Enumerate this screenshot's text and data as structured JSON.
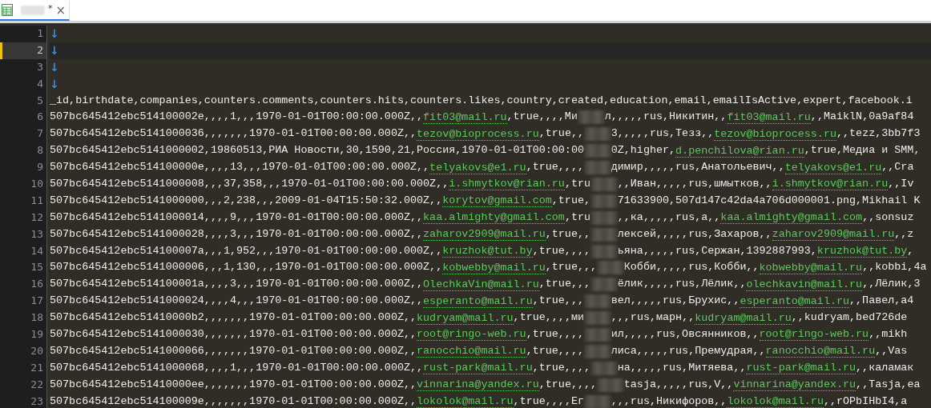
{
  "tab": {
    "modified_mark": "*",
    "close": "×",
    "selected": true
  },
  "editor": {
    "lines": [
      {
        "number": "1",
        "current": false,
        "bookmarked": false,
        "segments": [
          {
            "kind": "eol",
            "text": "↓"
          }
        ]
      },
      {
        "number": "2",
        "current": true,
        "bookmarked": true,
        "segments": [
          {
            "kind": "eol",
            "text": "↓"
          }
        ]
      },
      {
        "number": "3",
        "segments": [
          {
            "kind": "eol",
            "text": "↓"
          }
        ]
      },
      {
        "number": "4",
        "segments": [
          {
            "kind": "eol",
            "text": "↓"
          }
        ]
      },
      {
        "number": "5",
        "segments": [
          {
            "kind": "text",
            "text": "_id,birthdate,companies,counters.comments,counters.hits,counters.likes,country,created,education,email,emailIsActive,expert,facebook.i"
          }
        ]
      },
      {
        "number": "6",
        "segments": [
          {
            "kind": "text",
            "text": "507bc645412ebc514100002e,,,,1,,,1970-01-01T00:00:00.000Z,,"
          },
          {
            "kind": "link",
            "text": "fit03@mail.ru"
          },
          {
            "kind": "text",
            "text": ",true,,,,Ми"
          },
          {
            "kind": "blur"
          },
          {
            "kind": "text",
            "text": "л,,,,,rus,Никитин,,"
          },
          {
            "kind": "link",
            "text": "fit03@mail.ru"
          },
          {
            "kind": "text",
            "text": ",,MaiklN,0a9af84"
          }
        ]
      },
      {
        "number": "7",
        "segments": [
          {
            "kind": "text",
            "text": "507bc645412ebc5141000036,,,,,,,1970-01-01T00:00:00.000Z,,"
          },
          {
            "kind": "link",
            "text": "tezov@bioprocess.ru"
          },
          {
            "kind": "text",
            "text": ",true,,"
          },
          {
            "kind": "blur"
          },
          {
            "kind": "text",
            "text": "3,,,,,rus,Тезз,,"
          },
          {
            "kind": "link",
            "text": "tezov@bioprocess.ru"
          },
          {
            "kind": "text",
            "text": ",,tezz,3bb7f3"
          }
        ]
      },
      {
        "number": "8",
        "segments": [
          {
            "kind": "text",
            "text": "507bc645412ebc5141000002,19860513,РИА Новости,30,1590,21,Россия,1970-01-01T00:00:00"
          },
          {
            "kind": "blur"
          },
          {
            "kind": "text",
            "text": "0Z,higher,"
          },
          {
            "kind": "link",
            "text": "d.penchilova@rian.ru"
          },
          {
            "kind": "text",
            "text": ",true,Медиа и SMM,"
          }
        ]
      },
      {
        "number": "9",
        "segments": [
          {
            "kind": "text",
            "text": "507bc645412ebc514100000e,,,,13,,,1970-01-01T00:00:00.000Z,,"
          },
          {
            "kind": "link",
            "text": "telyakovs@e1.ru"
          },
          {
            "kind": "text",
            "text": ",true,,,,"
          },
          {
            "kind": "blur"
          },
          {
            "kind": "text",
            "text": "димир,,,,,rus,Анатольевич,,"
          },
          {
            "kind": "link",
            "text": "telyakovs@e1.ru"
          },
          {
            "kind": "text",
            "text": ",,Cra"
          }
        ]
      },
      {
        "number": "10",
        "segments": [
          {
            "kind": "text",
            "text": "507bc645412ebc5141000008,,,37,358,,,1970-01-01T00:00:00.000Z,,"
          },
          {
            "kind": "link",
            "text": "i.shmytkov@rian.ru"
          },
          {
            "kind": "text",
            "text": ",tru"
          },
          {
            "kind": "blur"
          },
          {
            "kind": "text",
            "text": ",,Иван,,,,,rus,шмытков,,"
          },
          {
            "kind": "link",
            "text": "i.shmytkov@rian.ru"
          },
          {
            "kind": "text",
            "text": ",,Iv"
          }
        ]
      },
      {
        "number": "11",
        "segments": [
          {
            "kind": "text",
            "text": "507bc645412ebc5141000000,,,2,238,,,2009-01-04T15:50:32.000Z,,"
          },
          {
            "kind": "link",
            "text": "korytov@gmail.com"
          },
          {
            "kind": "text",
            "text": ",true,"
          },
          {
            "kind": "blur"
          },
          {
            "kind": "text",
            "text": "71633900,507d147c42da4a706d000001.png,Mikhail K"
          }
        ]
      },
      {
        "number": "12",
        "segments": [
          {
            "kind": "text",
            "text": "507bc645412ebc5141000014,,,,9,,,1970-01-01T00:00:00.000Z,,"
          },
          {
            "kind": "link",
            "text": "kaa.almighty@gmail.com"
          },
          {
            "kind": "text",
            "text": ",tru"
          },
          {
            "kind": "blur"
          },
          {
            "kind": "text",
            "text": ",,ка,,,,,rus,а,,"
          },
          {
            "kind": "link",
            "text": "kaa.almighty@gmail.com"
          },
          {
            "kind": "text",
            "text": ",,sonsuz"
          }
        ]
      },
      {
        "number": "13",
        "segments": [
          {
            "kind": "text",
            "text": "507bc645412ebc5141000028,,,,3,,,1970-01-01T00:00:00.000Z,,"
          },
          {
            "kind": "link",
            "text": "zaharov2909@mail.ru"
          },
          {
            "kind": "text",
            "text": ",true,,"
          },
          {
            "kind": "blur"
          },
          {
            "kind": "text",
            "text": "лексей,,,,,rus,Захаров,,"
          },
          {
            "kind": "link",
            "text": "zaharov2909@mail.ru"
          },
          {
            "kind": "text",
            "text": ",,z"
          }
        ]
      },
      {
        "number": "14",
        "segments": [
          {
            "kind": "text",
            "text": "507bc645412ebc514100007a,,,1,952,,,1970-01-01T00:00:00.000Z,,"
          },
          {
            "kind": "link",
            "text": "kruzhok@tut.by"
          },
          {
            "kind": "text",
            "text": ",true,,,,"
          },
          {
            "kind": "blur"
          },
          {
            "kind": "text",
            "text": "ьяна,,,,,rus,Сержан,1392887993,"
          },
          {
            "kind": "link",
            "text": "kruzhok@tut.by"
          },
          {
            "kind": "text",
            "text": ","
          }
        ]
      },
      {
        "number": "15",
        "segments": [
          {
            "kind": "text",
            "text": "507bc645412ebc5141000006,,,1,130,,,1970-01-01T00:00:00.000Z,,"
          },
          {
            "kind": "link",
            "text": "kobwebby@mail.ru"
          },
          {
            "kind": "text",
            "text": ",true,,,"
          },
          {
            "kind": "blur"
          },
          {
            "kind": "text",
            "text": "Кобби,,,,,rus,Кобби,,"
          },
          {
            "kind": "link",
            "text": "kobwebby@mail.ru"
          },
          {
            "kind": "text",
            "text": ",,kobbi,4a"
          }
        ]
      },
      {
        "number": "16",
        "segments": [
          {
            "kind": "text",
            "text": "507bc645412ebc514100001a,,,,3,,,1970-01-01T00:00:00.000Z,,"
          },
          {
            "kind": "link",
            "text": "OlechkaVin@mail.ru"
          },
          {
            "kind": "text",
            "text": ",true,,,"
          },
          {
            "kind": "blur"
          },
          {
            "kind": "text",
            "text": "ёлик,,,,,rus,Лёлик,,"
          },
          {
            "kind": "link",
            "text": "olechkavin@mail.ru"
          },
          {
            "kind": "text",
            "text": ",,Лёлик,3"
          }
        ]
      },
      {
        "number": "17",
        "segments": [
          {
            "kind": "text",
            "text": "507bc645412ebc5141000024,,,,4,,,1970-01-01T00:00:00.000Z,,"
          },
          {
            "kind": "link",
            "text": "esperanto@mail.ru"
          },
          {
            "kind": "text",
            "text": ",true,,,"
          },
          {
            "kind": "blur"
          },
          {
            "kind": "text",
            "text": "вел,,,,,rus,Брухис,,"
          },
          {
            "kind": "link",
            "text": "esperanto@mail.ru"
          },
          {
            "kind": "text",
            "text": ",,Павел,а4"
          }
        ]
      },
      {
        "number": "18",
        "segments": [
          {
            "kind": "text",
            "text": "507bc645412ebc51410000b2,,,,,,,1970-01-01T00:00:00.000Z,,"
          },
          {
            "kind": "link",
            "text": "kudryam@mail.ru"
          },
          {
            "kind": "text",
            "text": ",true,,,,ми"
          },
          {
            "kind": "blur"
          },
          {
            "kind": "text",
            "text": ",,,rus,марн,,"
          },
          {
            "kind": "link",
            "text": "kudryam@mail.ru"
          },
          {
            "kind": "text",
            "text": ",,kudryam,bed726de"
          }
        ]
      },
      {
        "number": "19",
        "segments": [
          {
            "kind": "text",
            "text": "507bc645412ebc5141000030,,,,,,,1970-01-01T00:00:00.000Z,,"
          },
          {
            "kind": "link",
            "text": "root@ringo-web.ru"
          },
          {
            "kind": "text",
            "text": ",true,,,,"
          },
          {
            "kind": "blur"
          },
          {
            "kind": "text",
            "text": "ил,,,,,rus,Овсянников,,"
          },
          {
            "kind": "link",
            "text": "root@ringo-web.ru"
          },
          {
            "kind": "text",
            "text": ",,mikh"
          }
        ]
      },
      {
        "number": "20",
        "segments": [
          {
            "kind": "text",
            "text": "507bc645412ebc5141000066,,,,,,,1970-01-01T00:00:00.000Z,,"
          },
          {
            "kind": "link",
            "text": "ranocchio@mail.ru"
          },
          {
            "kind": "text",
            "text": ",true,,,,"
          },
          {
            "kind": "blur"
          },
          {
            "kind": "text",
            "text": "лиса,,,,,rus,Премудрая,,"
          },
          {
            "kind": "link",
            "text": "ranocchio@mail.ru"
          },
          {
            "kind": "text",
            "text": ",,Vas"
          }
        ]
      },
      {
        "number": "21",
        "segments": [
          {
            "kind": "text",
            "text": "507bc645412ebc5141000068,,,,1,,,1970-01-01T00:00:00.000Z,,"
          },
          {
            "kind": "link",
            "text": "rust-park@mail.ru"
          },
          {
            "kind": "text",
            "text": ",true,,,,"
          },
          {
            "kind": "blur"
          },
          {
            "kind": "text",
            "text": "на,,,,,rus,Митяева,,"
          },
          {
            "kind": "link",
            "text": "rust-park@mail.ru"
          },
          {
            "kind": "text",
            "text": ",,каламак"
          }
        ]
      },
      {
        "number": "22",
        "segments": [
          {
            "kind": "text",
            "text": "507bc645412ebc51410000ee,,,,,,,1970-01-01T00:00:00.000Z,,"
          },
          {
            "kind": "link",
            "text": "vinnarina@yandex.ru"
          },
          {
            "kind": "text",
            "text": ",true,,,,"
          },
          {
            "kind": "blur"
          },
          {
            "kind": "text",
            "text": "tasja,,,,,rus,V,,"
          },
          {
            "kind": "link",
            "text": "vinnarina@yandex.ru"
          },
          {
            "kind": "text",
            "text": ",,Tasja,ea"
          }
        ]
      },
      {
        "number": "23",
        "segments": [
          {
            "kind": "text",
            "text": "507bc645412ebc514100009e,,,,,,,1970-01-01T00:00:00.000Z,,"
          },
          {
            "kind": "link",
            "text": "lokolok@mail.ru"
          },
          {
            "kind": "text",
            "text": ",true,,,,Ег"
          },
          {
            "kind": "blur"
          },
          {
            "kind": "text",
            "text": ",,,rus,Никифоров,,"
          },
          {
            "kind": "link",
            "text": "lokolok@mail.ru"
          },
          {
            "kind": "text",
            "text": ",,rOPbIHbI4,a"
          }
        ]
      }
    ]
  }
}
